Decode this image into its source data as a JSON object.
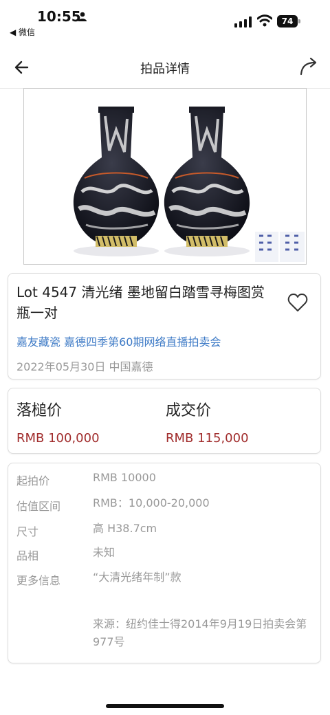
{
  "status_bar": {
    "time": "10:55",
    "back_app": "◀ 微信",
    "battery": "74"
  },
  "nav": {
    "title": "拍品详情"
  },
  "lot": {
    "title": "Lot 4547 清光绪  墨地留白踏雪寻梅图赏瓶一对",
    "auction": "嘉友藏瓷 嘉德四季第60期网络直播拍卖会",
    "date": "2022年05月30日 中国嘉德"
  },
  "prices": {
    "hammer_label": "落槌价",
    "hammer_value": "RMB 100,000",
    "deal_label": "成交价",
    "deal_value": "RMB 115,000"
  },
  "details": {
    "start_label": "起拍价",
    "start_value": "RMB 10000",
    "estimate_label": "估值区间",
    "estimate_value": "RMB：10,000-20,000",
    "size_label": "尺寸",
    "size_value": "高 H38.7cm",
    "condition_label": "品相",
    "condition_value": "未知",
    "more_label": "更多信息",
    "more_value": "“大清光绪年制”款",
    "provenance": "来源：纽约佳士得2014年9月19日拍卖会第977号"
  },
  "colors": {
    "link": "#3d7ac6",
    "price": "#a12d2d",
    "muted": "#999999"
  }
}
